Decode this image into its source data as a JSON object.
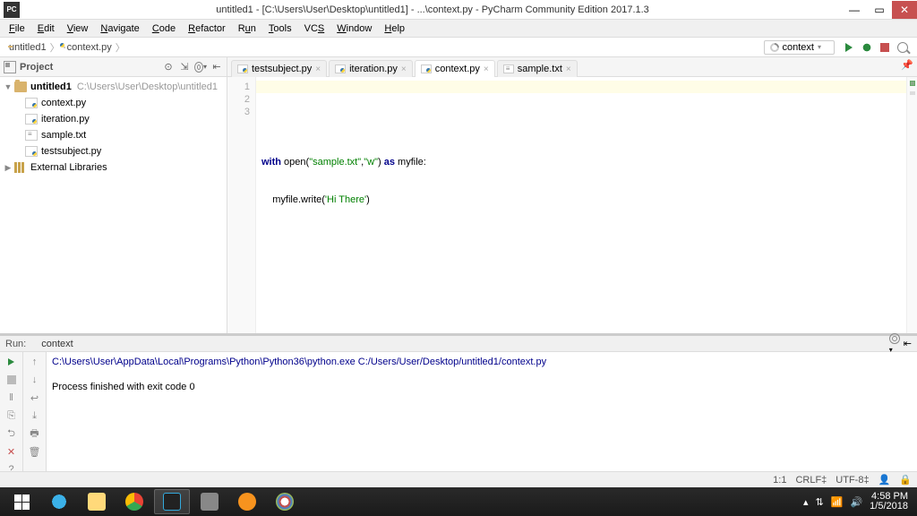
{
  "titlebar": {
    "app_badge": "PC",
    "title": "untitled1 - [C:\\Users\\User\\Desktop\\untitled1] - ...\\context.py - PyCharm Community Edition 2017.1.3"
  },
  "menu": {
    "file": "File",
    "edit": "Edit",
    "view": "View",
    "navigate": "Navigate",
    "code": "Code",
    "refactor": "Refactor",
    "run": "Run",
    "tools": "Tools",
    "vcs": "VCS",
    "window": "Window",
    "help": "Help"
  },
  "nav": {
    "crumb1": "untitled1",
    "crumb2": "context.py",
    "config_selected": "context"
  },
  "project": {
    "header": "Project",
    "root_name": "untitled1",
    "root_path": "C:\\Users\\User\\Desktop\\untitled1",
    "files": [
      "context.py",
      "iteration.py",
      "sample.txt",
      "testsubject.py"
    ],
    "external": "External Libraries"
  },
  "tabs": [
    {
      "label": "testsubject.py",
      "type": "py",
      "active": false
    },
    {
      "label": "iteration.py",
      "type": "py",
      "active": false
    },
    {
      "label": "context.py",
      "type": "py",
      "active": true
    },
    {
      "label": "sample.txt",
      "type": "txt",
      "active": false
    }
  ],
  "code": {
    "lines": [
      "1",
      "2",
      "3"
    ],
    "l1": "",
    "l2_kw1": "with",
    "l2_fn": " open(",
    "l2_s1": "\"sample.txt\"",
    "l2_c1": ",",
    "l2_s2": "\"w\"",
    "l2_c2": ") ",
    "l2_kw2": "as",
    "l2_id": " myfile:",
    "l3_indent": "    ",
    "l3_call": "myfile.write(",
    "l3_s": "'Hi There'",
    "l3_end": ")"
  },
  "run": {
    "label": "Run:",
    "name": "context",
    "cmd": "C:\\Users\\User\\AppData\\Local\\Programs\\Python\\Python36\\python.exe C:/Users/User/Desktop/untitled1/context.py",
    "exit": "Process finished with exit code 0"
  },
  "status": {
    "pos": "1:1",
    "eol": "CRLF",
    "enc": "UTF-8"
  },
  "tray": {
    "time": "4:58 PM",
    "date": "1/5/2018"
  }
}
